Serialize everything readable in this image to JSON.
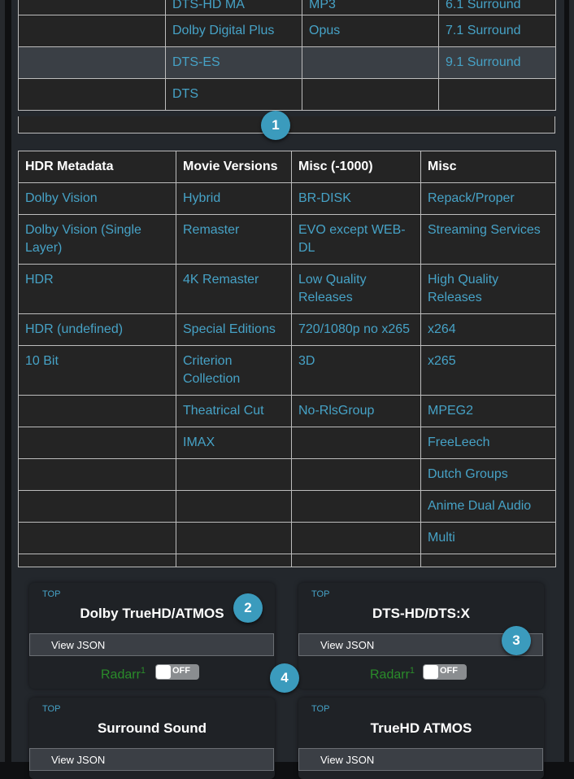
{
  "top_table": {
    "rows": [
      {
        "c2": "DTS-HD MA",
        "c3": "MP3",
        "c4": "6.1 Surround"
      },
      {
        "c2": "Dolby Digital Plus",
        "c3": "Opus",
        "c4": "7.1 Surround"
      },
      {
        "c2": "DTS-ES",
        "c3": "",
        "c4": "9.1 Surround"
      },
      {
        "c2": "DTS",
        "c3": "",
        "c4": ""
      }
    ]
  },
  "cf_table": {
    "headers": [
      "HDR Metadata",
      "Movie Versions",
      "Misc (-1000)",
      "Misc"
    ],
    "rows": [
      [
        "Dolby Vision",
        "Hybrid",
        "BR-DISK",
        "Repack/Proper"
      ],
      [
        "Dolby Vision (Single Layer)",
        "Remaster",
        "EVO except WEB-DL",
        "Streaming Services"
      ],
      [
        "HDR",
        "4K Remaster",
        "Low Quality Releases",
        "High Quality Releases"
      ],
      [
        "HDR (undefined)",
        "Special Editions",
        "720/1080p no x265",
        "x264"
      ],
      [
        "10 Bit",
        "Criterion Collection",
        "3D",
        "x265"
      ],
      [
        "",
        "Theatrical Cut",
        "No-RlsGroup",
        "MPEG2"
      ],
      [
        "",
        "IMAX",
        "",
        "FreeLeech"
      ],
      [
        "",
        "",
        "",
        "Dutch Groups"
      ],
      [
        "",
        "",
        "",
        "Anime Dual Audio"
      ],
      [
        "",
        "",
        "",
        "Multi"
      ],
      [
        "",
        "",
        "",
        ""
      ]
    ]
  },
  "cards": [
    {
      "top": "TOP",
      "title": "Dolby TrueHD/ATMOS",
      "button": "View JSON",
      "radarr": "Radarr",
      "sup": "1",
      "toggle": "OFF"
    },
    {
      "top": "TOP",
      "title": "DTS-HD/DTS:X",
      "button": "View JSON",
      "radarr": "Radarr",
      "sup": "1",
      "toggle": "OFF"
    },
    {
      "top": "TOP",
      "title": "Surround Sound",
      "button": "View JSON"
    },
    {
      "top": "TOP",
      "title": "TrueHD ATMOS",
      "button": "View JSON"
    }
  ],
  "badges": [
    "1",
    "2",
    "3",
    "4"
  ],
  "colors": {
    "link": "#46a2c6",
    "badge": "#3b9bbd",
    "radarr": "#2a8c2a",
    "panel": "#23272c"
  }
}
